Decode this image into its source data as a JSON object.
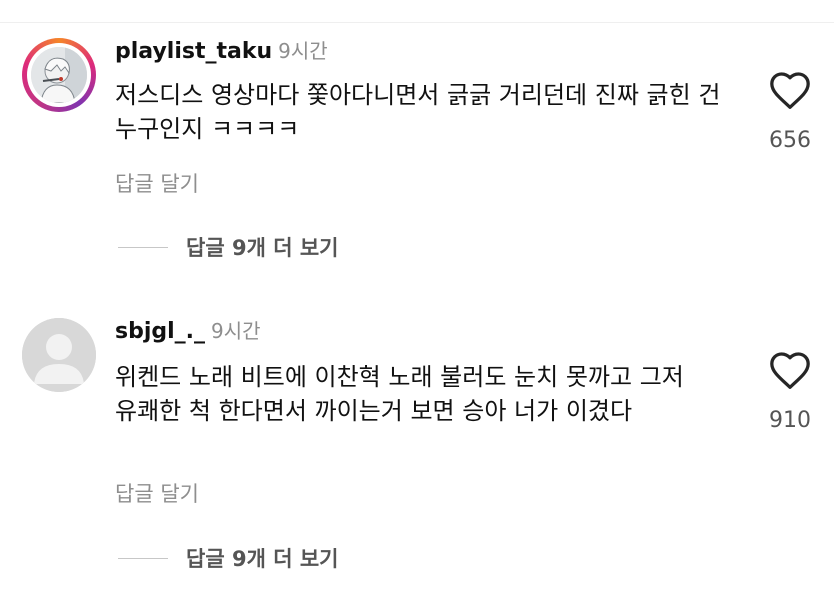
{
  "comments": [
    {
      "username": "playlist_taku",
      "time": "9시간",
      "text": "저스디스 영상마다 쫓아다니면서 긁긁 거리던데 진짜 긁힌 건 누구인지 ㅋㅋㅋㅋ",
      "reply_label": "답글 달기",
      "likes": "656",
      "view_replies": "답글 9개 더 보기",
      "avatar": "story-ring-avatar"
    },
    {
      "username": "sbjgl_._",
      "time": "9시간",
      "text": "위켄드 노래 비트에 이찬혁 노래 불러도 눈치 못까고 그저 유쾌한 척 한다면서 까이는거 보면 승아 너가 이겼다",
      "reply_label": "답글 달기",
      "likes": "910",
      "view_replies": "답글 9개 더 보기",
      "avatar": "default-avatar"
    }
  ],
  "icons": {
    "like": "heart-outline-icon"
  },
  "colors": {
    "story_ring": [
      "#f58529",
      "#dd2a7b",
      "#8134af"
    ],
    "secondary_text": "#8e8e8e"
  }
}
